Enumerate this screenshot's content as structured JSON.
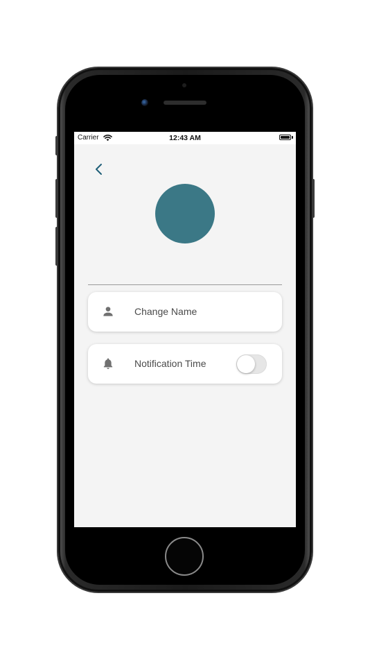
{
  "status_bar": {
    "carrier": "Carrier",
    "time": "12:43 AM",
    "wifi_icon": "wifi-icon",
    "battery_icon": "battery-full-icon"
  },
  "header": {
    "back_icon": "chevron-left-icon",
    "accent_color": "#1f5f78"
  },
  "profile": {
    "avatar_color": "#3b7886"
  },
  "settings": {
    "items": [
      {
        "icon": "person-icon",
        "label": "Change Name"
      },
      {
        "icon": "bell-icon",
        "label": "Notification Time",
        "toggle_on": false
      }
    ]
  },
  "colors": {
    "screen_background": "#f4f4f4",
    "card_background": "#ffffff",
    "icon_color": "#707070",
    "label_color": "#4a4a4a"
  }
}
